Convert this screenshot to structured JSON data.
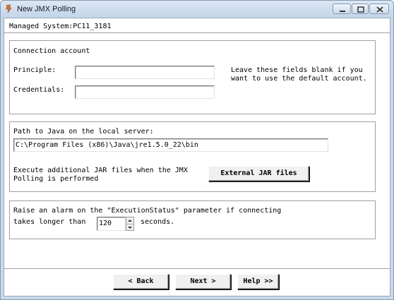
{
  "window": {
    "title": "New JMX Polling",
    "icons": {
      "app": "jmx-java-icon",
      "minimize": "minimize-icon",
      "maximize": "maximize-icon",
      "close": "close-icon"
    }
  },
  "managed_system": "Managed System:PC11_3181",
  "connection": {
    "heading": "Connection account",
    "principle_label": "Principle:",
    "principle_value": "",
    "credentials_label": "Credentials:",
    "credentials_value": "",
    "hint": "Leave these fields blank if you want to use the default account."
  },
  "java": {
    "path_label": "Path to Java on the local server:",
    "path_value": "C:\\Program Files (x86)\\Java\\jre1.5.0_22\\bin",
    "jar_label": "Execute additional JAR files when the JMX Polling is performed",
    "jar_button": "External JAR files"
  },
  "alarm": {
    "text_line1": "Raise an alarm on the \"ExecutionStatus\" parameter if connecting",
    "text_prefix": "takes longer than",
    "timeout_value": "120",
    "text_suffix": "seconds."
  },
  "nav": {
    "back": "< Back",
    "next": "Next >",
    "help": "Help >>"
  }
}
